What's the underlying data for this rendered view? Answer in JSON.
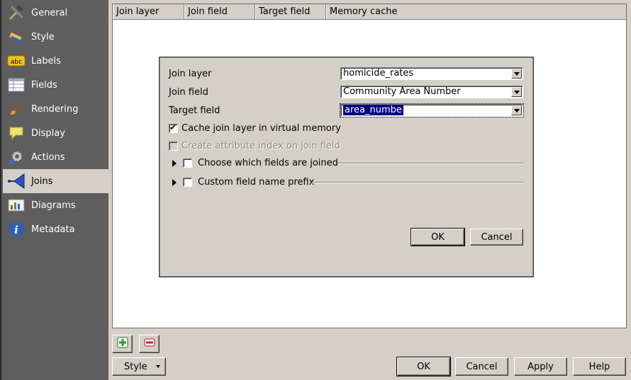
{
  "sidebar": {
    "items": [
      {
        "label": "General",
        "icon": "tools-icon"
      },
      {
        "label": "Style",
        "icon": "paintbrush-icon"
      },
      {
        "label": "Labels",
        "icon": "abc-label-icon"
      },
      {
        "label": "Fields",
        "icon": "table-icon"
      },
      {
        "label": "Rendering",
        "icon": "brush-icon"
      },
      {
        "label": "Display",
        "icon": "speech-bubble-icon"
      },
      {
        "label": "Actions",
        "icon": "gear-icon"
      },
      {
        "label": "Joins",
        "icon": "join-icon"
      },
      {
        "label": "Diagrams",
        "icon": "diagram-icon"
      },
      {
        "label": "Metadata",
        "icon": "info-icon"
      }
    ],
    "active": "Joins"
  },
  "joins_table": {
    "columns": [
      "Join layer",
      "Join field",
      "Target field",
      "Memory cache"
    ]
  },
  "dialog": {
    "join_layer_label": "Join layer",
    "join_layer_value": "homicide_rates",
    "join_field_label": "Join field",
    "join_field_value": "Community Area Number",
    "target_field_label": "Target field",
    "target_field_value": "area_numbe",
    "cache_label": "Cache join layer in virtual memory",
    "cache_checked": true,
    "index_label": "Create attribute index on join field",
    "choose_fields_label": "Choose which fields are joined",
    "prefix_label": "Custom field name prefix",
    "ok_label": "OK",
    "cancel_label": "Cancel"
  },
  "bottom": {
    "add_icon": "plus-icon",
    "remove_icon": "minus-icon",
    "style_label": "Style",
    "ok_label": "OK",
    "cancel_label": "Cancel",
    "apply_label": "Apply",
    "help_label": "Help"
  },
  "colors": {
    "sidebar_bg": "#5e5e5e",
    "window_bg": "#d4d0c8",
    "selection": "#000080"
  }
}
